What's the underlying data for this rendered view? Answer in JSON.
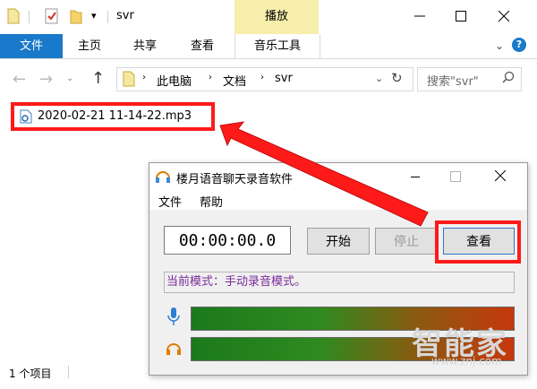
{
  "explorer": {
    "title": "svr",
    "context_tab": "播放",
    "ribbon_tabs": [
      "文件",
      "主页",
      "共享",
      "查看",
      "音乐工具"
    ],
    "breadcrumb": [
      "此电脑",
      "文档",
      "svr"
    ],
    "search_placeholder": "搜索\"svr\"",
    "file_name": "2020-02-21 11-14-22.mp3",
    "status_text": "1 个项目"
  },
  "recorder": {
    "title": "楼月语音聊天录音软件",
    "menu": [
      "文件",
      "帮助"
    ],
    "time": "00:00:00.0",
    "start_label": "开始",
    "stop_label": "停止",
    "view_label": "查看",
    "mode_text": "当前模式：手动录音模式。"
  },
  "watermark": {
    "brand": "智能家",
    "url": "www.znj.com"
  },
  "colors": {
    "ribbon_file_tab": "#1979ca",
    "context_tab_bg": "#f6eeaa",
    "highlight_red": "#ff1a1a",
    "mode_text": "#7a2a9a"
  }
}
